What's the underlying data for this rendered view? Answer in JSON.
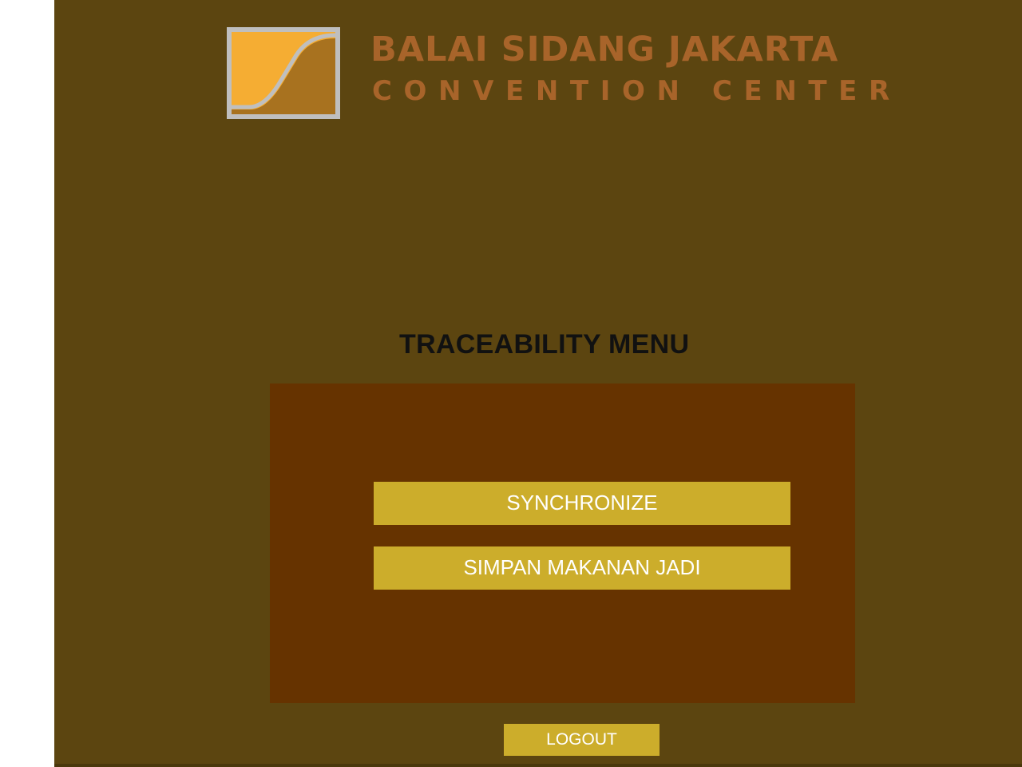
{
  "header": {
    "brand_line_1": "BALAI SIDANG JAKARTA",
    "brand_line_2": "CONVENTION CENTER",
    "logo_icon": "jcc-logo-icon"
  },
  "menu": {
    "title": "TRACEABILITY MENU",
    "buttons": [
      {
        "label": "SYNCHRONIZE"
      },
      {
        "label": "SIMPAN MAKANAN JADI"
      }
    ]
  },
  "footer": {
    "logout_label": "LOGOUT"
  },
  "colors": {
    "page_background": "#5c4510",
    "panel_background": "#663300",
    "button_background": "#ccad2b",
    "button_text": "#ffffff",
    "brand_text": "#a8642a",
    "logo_orange": "#f5ad33",
    "logo_brown": "#a8721f",
    "logo_frame": "#bfbfbf"
  }
}
